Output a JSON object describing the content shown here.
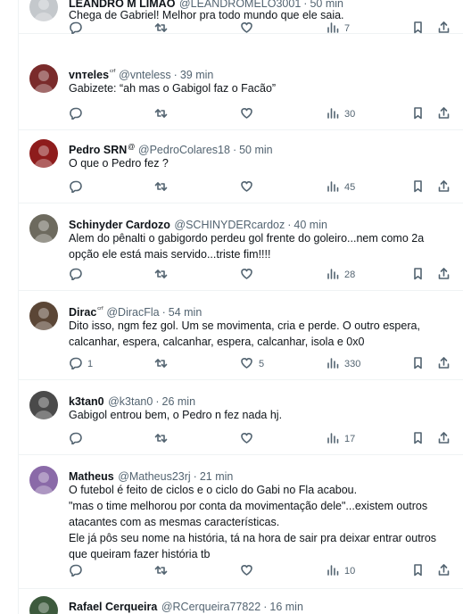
{
  "tweets": [
    {
      "name": "LEANDRO M LIMAO",
      "badge": "",
      "handle": "@LEANDROMELO3001",
      "time": "50 min",
      "text": "Chega de Gabriel! Melhor pra todo mundo que ele saia.",
      "replies": "",
      "retweets": "",
      "likes": "",
      "views": "7",
      "avatar_color": "#c4c8cc"
    },
    {
      "name": "vnтeles",
      "badge": "ᶜʳᶠ",
      "handle": "@vnteless",
      "time": "39 min",
      "text": "Gabizete: “ah mas o Gabigol faz o Facão”",
      "replies": "",
      "retweets": "",
      "likes": "",
      "views": "30",
      "avatar_color": "#7a2b2b"
    },
    {
      "name": "Pedro SRN",
      "badge": "@",
      "handle": "@PedroColares18",
      "time": "50 min",
      "text": "O que o Pedro fez ?",
      "replies": "",
      "retweets": "",
      "likes": "",
      "views": "45",
      "avatar_color": "#8e1c1c"
    },
    {
      "name": "Schinyder Cardozo",
      "badge": "",
      "handle": "@SCHINYDERcardoz",
      "time": "40 min",
      "text": "Alem do pênalti o gabigordo perdeu gol frente do goleiro...nem como 2a opção ele está mais servido...triste fim!!!!",
      "replies": "",
      "retweets": "",
      "likes": "",
      "views": "28",
      "avatar_color": "#6d6a5e"
    },
    {
      "name": "Dirac",
      "badge": "ᶜʳᶠ",
      "handle": "@DiracFla",
      "time": "54 min",
      "text": "Dito isso, ngm fez gol. Um se movimenta, cria e perde. O outro espera, calcanhar, espera, calcanhar, espera, calcanhar, isola e 0x0",
      "replies": "1",
      "retweets": "",
      "likes": "5",
      "views": "330",
      "avatar_color": "#5b4636"
    },
    {
      "name": "k3tan0",
      "badge": "",
      "handle": "@k3tan0",
      "time": "26 min",
      "text": "Gabigol entrou bem, o Pedro n fez nada hj.",
      "replies": "",
      "retweets": "",
      "likes": "",
      "views": "17",
      "avatar_color": "#4a4a4a"
    },
    {
      "name": "Matheus",
      "badge": "",
      "handle": "@Matheus23rj",
      "time": "21 min",
      "text": "O futebol é feito de ciclos e o ciclo do Gabi no Fla acabou.\n\"mas o time melhorou por conta da movimentação dele\"...existem outros atacantes com as mesmas características.\nEle já pôs seu nome na história, tá na hora de sair pra deixar entrar outros que queiram fazer história tb",
      "replies": "",
      "retweets": "",
      "likes": "",
      "views": "10",
      "avatar_color": "#8a6aa8"
    },
    {
      "name": "Rafael Cerqueira",
      "badge": "",
      "handle": "@RCerqueira77822",
      "time": "16 min",
      "text": "",
      "replies": "",
      "retweets": "",
      "likes": "",
      "views": "",
      "avatar_color": "#3d5a3d"
    }
  ]
}
